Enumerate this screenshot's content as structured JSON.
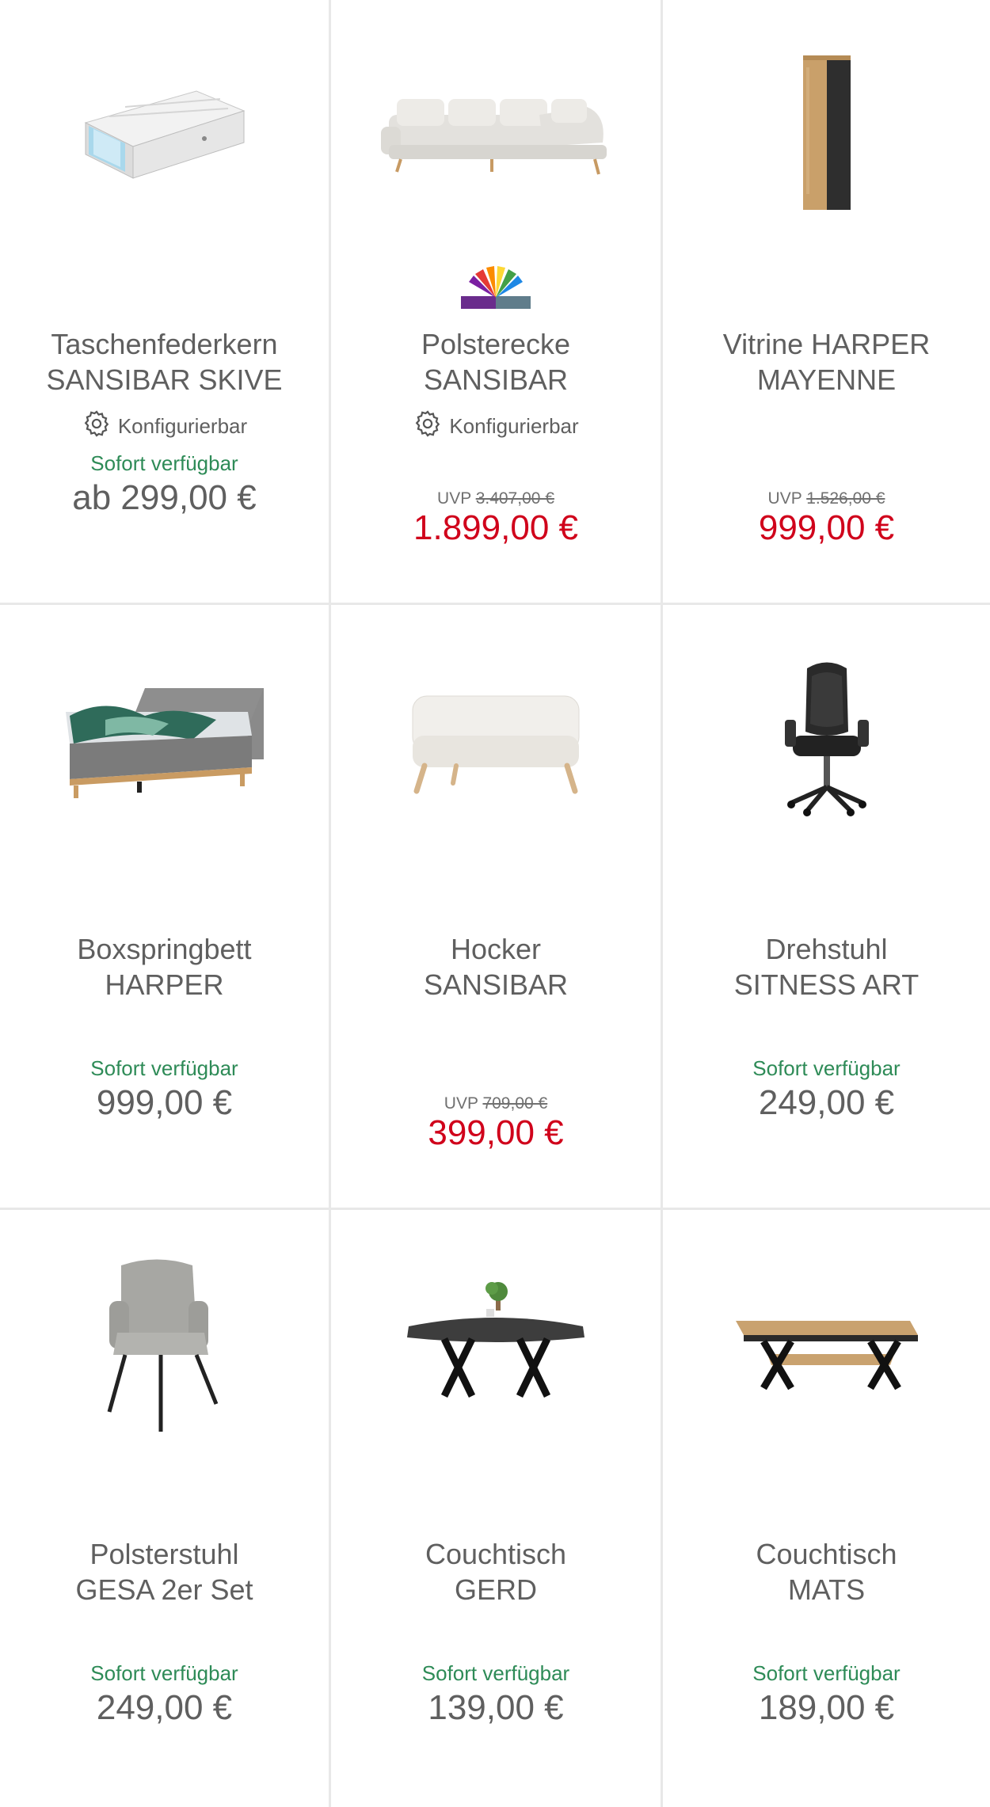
{
  "products": [
    {
      "title_line1": "Taschenfederkern",
      "title_line2": "SANSIBAR SKIVE",
      "icon": "mattress-image",
      "config_label": "Konfigurierbar",
      "stock": "Sofort verfügbar",
      "price": "ab 299,00 €"
    },
    {
      "title_line1": "Polsterecke",
      "title_line2": "SANSIBAR",
      "icon": "corner-sofa-image",
      "badge_icon": "color-fan-icon",
      "config_label": "Konfigurierbar",
      "uvp_label": "UVP",
      "uvp_price": "3.407,00 €",
      "sale_price": "1.899,00 €"
    },
    {
      "title_line1": "Vitrine HARPER",
      "title_line2": "MAYENNE",
      "icon": "vitrine-cabinet-image",
      "uvp_label": "UVP",
      "uvp_price": "1.526,00 €",
      "sale_price": "999,00 €"
    },
    {
      "title_line1": "Boxspringbett",
      "title_line2": "HARPER",
      "icon": "boxspring-bed-image",
      "stock": "Sofort verfügbar",
      "price": "999,00 €"
    },
    {
      "title_line1": "Hocker",
      "title_line2": "SANSIBAR",
      "icon": "ottoman-image",
      "uvp_label": "UVP",
      "uvp_price": "709,00 €",
      "sale_price": "399,00 €"
    },
    {
      "title_line1": "Drehstuhl",
      "title_line2": "SITNESS ART",
      "icon": "office-chair-image",
      "stock": "Sofort verfügbar",
      "price": "249,00 €"
    },
    {
      "title_line1": "Polsterstuhl",
      "title_line2": "GESA 2er Set",
      "icon": "upholstered-chair-image",
      "stock": "Sofort verfügbar",
      "price": "249,00 €"
    },
    {
      "title_line1": "Couchtisch",
      "title_line2": "GERD",
      "icon": "coffee-table-gerd-image",
      "stock": "Sofort verfügbar",
      "price": "139,00 €"
    },
    {
      "title_line1": "Couchtisch",
      "title_line2": "MATS",
      "icon": "coffee-table-mats-image",
      "stock": "Sofort verfügbar",
      "price": "189,00 €"
    }
  ],
  "colors": {
    "stock_green": "#2e8b57",
    "sale_red": "#d0021b",
    "text_gray": "#5f5f5f",
    "divider": "#e8e8e8"
  }
}
